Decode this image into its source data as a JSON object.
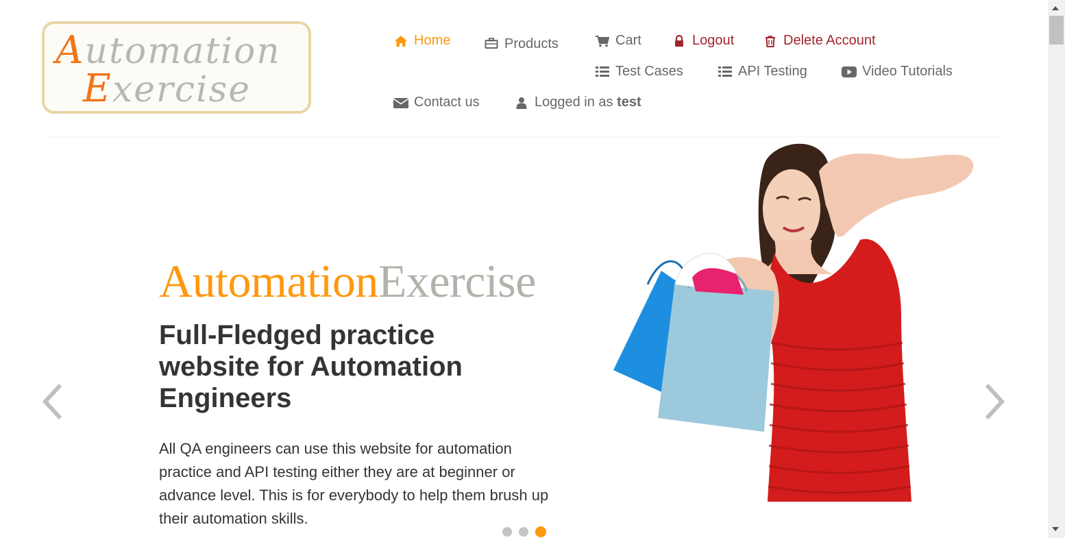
{
  "logo": {
    "line1_cap": "A",
    "line1_rest": "utomation",
    "line2_cap": "E",
    "line2_rest": "xercise"
  },
  "nav": {
    "home": "Home",
    "products": "Products",
    "cart": "Cart",
    "logout": "Logout",
    "delete_account": "Delete Account",
    "test_cases": "Test Cases",
    "api_testing": "API Testing",
    "video_tutorials": "Video Tutorials",
    "contact_us": "Contact us",
    "logged_in_prefix": "Logged in as",
    "username": "test"
  },
  "slider": {
    "title_part1": "Automation",
    "title_part2": "Exercise",
    "heading": "Full-Fledged practice website for Automation Engineers",
    "text": "All QA engineers can use this website for automation practice and API testing either they are at beginner or advance level. This is for everybody to help them brush up their automation skills.",
    "active_slide": 3,
    "slide_count": 3
  },
  "icons": {
    "home": "home-icon",
    "products": "briefcase-icon",
    "cart": "cart-icon",
    "logout": "lock-icon",
    "delete": "trash-icon",
    "test_cases": "list-icon",
    "api": "list-icon",
    "video": "youtube-play-icon",
    "contact": "envelope-icon",
    "user": "user-icon"
  },
  "colors": {
    "accent": "#fe980f",
    "danger": "#a2252c",
    "text": "#696763",
    "heading": "#363432"
  }
}
